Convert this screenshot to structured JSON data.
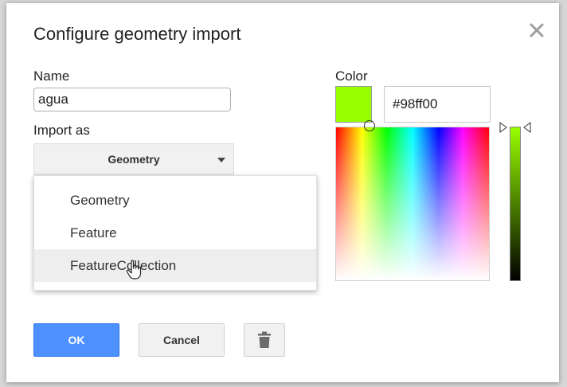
{
  "dialog": {
    "title": "Configure geometry import",
    "close_icon": "close-icon"
  },
  "name_field": {
    "label": "Name",
    "value": "agua"
  },
  "import_as": {
    "label": "Import as",
    "selected": "Geometry",
    "options": [
      "Geometry",
      "Feature",
      "FeatureCollection"
    ],
    "hovered_option": "FeatureCollection"
  },
  "color": {
    "label": "Color",
    "hex_value": "#98ff00",
    "swatch_color": "#98ff00"
  },
  "buttons": {
    "ok": "OK",
    "cancel": "Cancel",
    "delete_icon": "trash-icon"
  },
  "colors": {
    "primary_button": "#4d90fe",
    "dialog_background": "#ffffff"
  }
}
